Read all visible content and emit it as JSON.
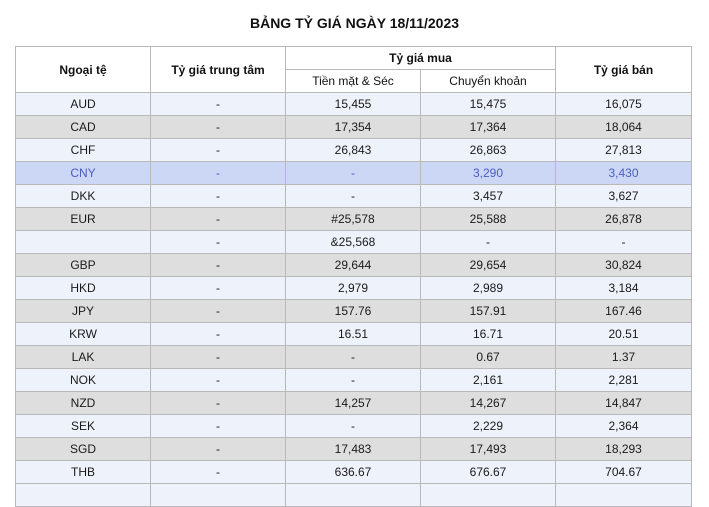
{
  "title": "BẢNG TỶ GIÁ NGÀY 18/11/2023",
  "headers": {
    "currency": "Ngoại tệ",
    "central": "Tỷ giá trung tâm",
    "buy": "Tỷ giá mua",
    "buy_cash": "Tiền mặt & Séc",
    "buy_transfer": "Chuyển khoản",
    "sell": "Tỷ giá bán"
  },
  "rows": [
    {
      "currency": "AUD",
      "central": "-",
      "cash": "15,455",
      "transfer": "15,475",
      "sell": "16,075"
    },
    {
      "currency": "CAD",
      "central": "-",
      "cash": "17,354",
      "transfer": "17,364",
      "sell": "18,064"
    },
    {
      "currency": "CHF",
      "central": "-",
      "cash": "26,843",
      "transfer": "26,863",
      "sell": "27,813"
    },
    {
      "currency": "CNY",
      "central": "-",
      "cash": "-",
      "transfer": "3,290",
      "sell": "3,430"
    },
    {
      "currency": "DKK",
      "central": "-",
      "cash": "-",
      "transfer": "3,457",
      "sell": "3,627"
    },
    {
      "currency": "EUR",
      "central": "-",
      "cash": "#25,578",
      "transfer": "25,588",
      "sell": "26,878"
    },
    {
      "currency": "",
      "central": "-",
      "cash": "&25,568",
      "transfer": "-",
      "sell": "-"
    },
    {
      "currency": "GBP",
      "central": "-",
      "cash": "29,644",
      "transfer": "29,654",
      "sell": "30,824"
    },
    {
      "currency": "HKD",
      "central": "-",
      "cash": "2,979",
      "transfer": "2,989",
      "sell": "3,184"
    },
    {
      "currency": "JPY",
      "central": "-",
      "cash": "157.76",
      "transfer": "157.91",
      "sell": "167.46"
    },
    {
      "currency": "KRW",
      "central": "-",
      "cash": "16.51",
      "transfer": "16.71",
      "sell": "20.51"
    },
    {
      "currency": "LAK",
      "central": "-",
      "cash": "-",
      "transfer": "0.67",
      "sell": "1.37"
    },
    {
      "currency": "NOK",
      "central": "-",
      "cash": "-",
      "transfer": "2,161",
      "sell": "2,281"
    },
    {
      "currency": "NZD",
      "central": "-",
      "cash": "14,257",
      "transfer": "14,267",
      "sell": "14,847"
    },
    {
      "currency": "SEK",
      "central": "-",
      "cash": "-",
      "transfer": "2,229",
      "sell": "2,364"
    },
    {
      "currency": "SGD",
      "central": "-",
      "cash": "17,483",
      "transfer": "17,493",
      "sell": "18,293"
    },
    {
      "currency": "THB",
      "central": "-",
      "cash": "636.67",
      "transfer": "676.67",
      "sell": "704.67"
    }
  ],
  "colors": {
    "row_light": "#eef2fb",
    "row_dark": "#dedede",
    "row_highlight": "#ccd7f6",
    "highlight_text": "#4a5ec2",
    "border": "#b9b9b9"
  }
}
